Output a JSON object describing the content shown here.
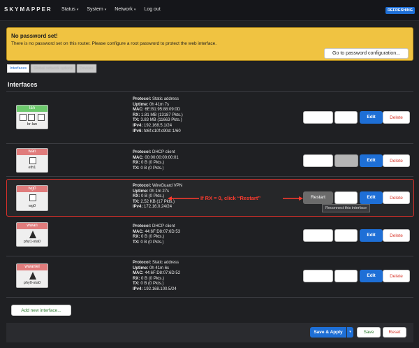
{
  "header": {
    "logo": "SKYMAPPER",
    "nav": [
      {
        "label": "Status",
        "has_caret": true
      },
      {
        "label": "System",
        "has_caret": true
      },
      {
        "label": "Network",
        "has_caret": true
      },
      {
        "label": "Log out",
        "has_caret": false
      }
    ],
    "refresh_badge": "REFRESHING",
    "caret_glyph": "▾"
  },
  "warning": {
    "title": "No password set!",
    "text": "There is no password set on this router. Please configure a root password to protect the web interface.",
    "button": "Go to password configuration..."
  },
  "tabs": [
    {
      "label": "Interfaces"
    },
    {
      "label": "Global network options"
    },
    {
      "label": "Devices"
    }
  ],
  "section_title": "Interfaces",
  "interfaces": [
    {
      "name": "lan",
      "device": "br-lan",
      "badge_color": "#6cc96c",
      "lines": [
        {
          "k": "Protocol:",
          "v": "Static address"
        },
        {
          "k": "Uptime:",
          "v": "0h 41m 7s"
        },
        {
          "k": "MAC:",
          "v": "6E:B1:95:88:09:0D"
        },
        {
          "k": "RX:",
          "v": "1.81 MB (13187 Pkts.)"
        },
        {
          "k": "TX:",
          "v": "3.83 MB (11663 Pkts.)"
        },
        {
          "k": "IPv4:",
          "v": "192.168.5.1/24"
        },
        {
          "k": "IPv6:",
          "v": "fd6f:c10f:c90d::1/60"
        }
      ]
    },
    {
      "name": "wan",
      "device": "eth1",
      "badge_color": "#e07c7c",
      "lines": [
        {
          "k": "Protocol:",
          "v": "DHCP client"
        },
        {
          "k": "MAC:",
          "v": "00:00:00:00:00:01"
        },
        {
          "k": "RX:",
          "v": "0 B (0 Pkts.)"
        },
        {
          "k": "TX:",
          "v": "0 B (0 Pkts.)"
        }
      ]
    },
    {
      "name": "wg0",
      "device": "wg0",
      "badge_color": "#e07c7c",
      "lines": [
        {
          "k": "Protocol:",
          "v": "WireGuard VPN"
        },
        {
          "k": "Uptime:",
          "v": "0h 1m 27s"
        },
        {
          "k": "RX:",
          "v": "0 B (0 Pkts.)"
        },
        {
          "k": "TX:",
          "v": "2.52 KB (17 Pkts.)"
        },
        {
          "k": "IPv4:",
          "v": "172.16.0.24/24"
        }
      ]
    },
    {
      "name": "wwan",
      "device": "phy1-sta0",
      "badge_color": "#e07c7c",
      "lines": [
        {
          "k": "Protocol:",
          "v": "DHCP client"
        },
        {
          "k": "MAC:",
          "v": "44:6F:D8:07:6D:53"
        },
        {
          "k": "RX:",
          "v": "0 B (0 Pkts.)"
        },
        {
          "k": "TX:",
          "v": "0 B (0 Pkts.)"
        }
      ]
    },
    {
      "name": "wwanlel",
      "device": "phy0-sta0",
      "badge_color": "#e07c7c",
      "lines": [
        {
          "k": "Protocol:",
          "v": "Static address"
        },
        {
          "k": "Uptime:",
          "v": "0h 41m 6s"
        },
        {
          "k": "MAC:",
          "v": "44:6F:D8:07:6D:52"
        },
        {
          "k": "RX:",
          "v": "0 B (0 Pkts.)"
        },
        {
          "k": "TX:",
          "v": "0 B (0 Pkts.)"
        },
        {
          "k": "IPv4:",
          "v": "192.168.100.5/24"
        }
      ]
    }
  ],
  "row_buttons": {
    "edit": "Edit",
    "delete": "Delete",
    "restart": "Restart"
  },
  "restart_tooltip": "Reconnect this interface",
  "annotation": "If RX = 0, click “Restart”",
  "add_button": "Add new interface...",
  "footer": {
    "save_apply": "Save & Apply",
    "save": "Save",
    "reset": "Reset"
  },
  "icons": {
    "device": "network-device-icon",
    "wireless": "wifi-antenna-icon"
  },
  "colors": {
    "accent": "#1e6fd6",
    "danger": "#d93a2e",
    "warning": "#f0c341",
    "success": "#2f7d32"
  }
}
